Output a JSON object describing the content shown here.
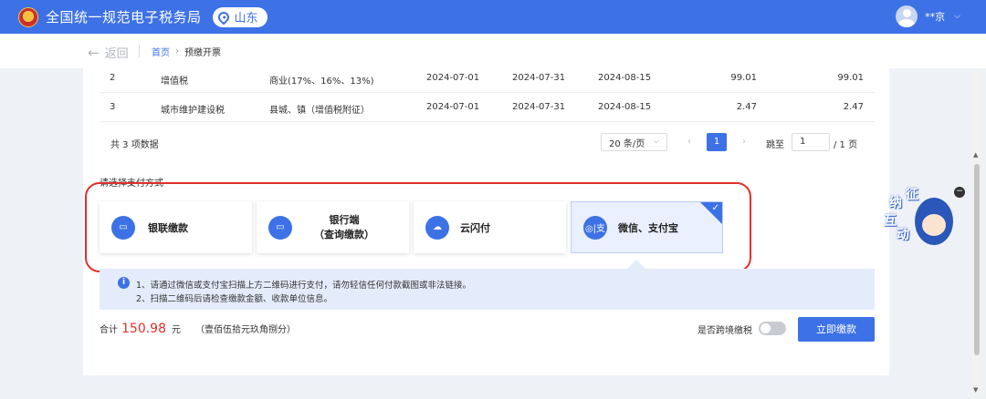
{
  "header": {
    "brand": "全国统一规范电子税务局",
    "province": "山东",
    "user": "**京"
  },
  "breadcrumb": {
    "back_label": "返回",
    "home": "首页",
    "current": "预缴开票"
  },
  "table": {
    "rows": [
      {
        "index": "2",
        "tax": "增值税",
        "item": "商业(17%、16%、13%)",
        "start": "2024-07-01",
        "end": "2024-07-31",
        "deadline": "2024-08-15",
        "amount": "99.01",
        "paid": "99.01"
      },
      {
        "index": "3",
        "tax": "城市维护建设税",
        "item": "县城、镇（增值税附征）",
        "start": "2024-07-01",
        "end": "2024-07-31",
        "deadline": "2024-08-15",
        "amount": "2.47",
        "paid": "2.47"
      }
    ]
  },
  "pagination": {
    "total": "共 3 项数据",
    "page_size": "20 条/页",
    "current_page": "1",
    "jump_label": "跳至",
    "jump_value": "1",
    "pages": "/ 1 页"
  },
  "payment": {
    "title": "请选择支付方式",
    "options": [
      {
        "label": "银联缴款"
      },
      {
        "label": "银行端",
        "sublabel": "（查询缴款）"
      },
      {
        "label": "云闪付"
      },
      {
        "label": "微信、支付宝",
        "selected": true
      }
    ]
  },
  "notice": {
    "line1": "1、请通过微信或支付宝扫描上方二维码进行支付，请勿轻信任何付款截图或非法链接。",
    "line2": "2、扫描二维码后请检查缴款金额、收款单位信息。"
  },
  "summary": {
    "label": "合计",
    "amount": "150.98",
    "unit": "元",
    "chinese": "（壹佰伍拾元玖角捌分）"
  },
  "cross_border_label": "是否跨境缴税",
  "pay_button": "立即缴款",
  "mascot": {
    "chars": [
      "征",
      "纳",
      "互",
      "动"
    ]
  },
  "colors": {
    "primary": "#3d71e6",
    "highlight": "#e0302a",
    "notice_bg": "#e4ecfb"
  }
}
